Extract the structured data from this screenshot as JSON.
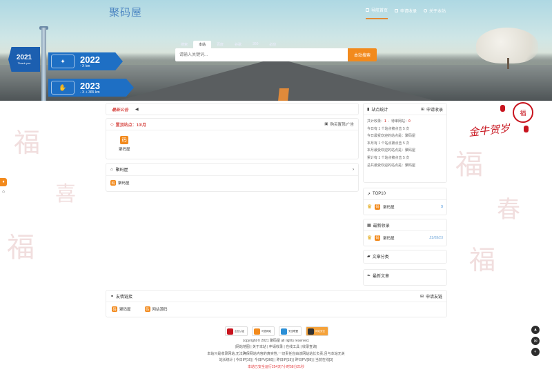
{
  "brand": {
    "logo": "聚码屋"
  },
  "nav": [
    {
      "label": "导航首页",
      "icon": "home-icon",
      "active": true
    },
    {
      "label": "申请收录",
      "icon": "edit-icon",
      "active": false
    },
    {
      "label": "关于本站",
      "icon": "info-icon",
      "active": false
    }
  ],
  "search": {
    "tabs": [
      "搜索",
      "本站",
      "百度",
      "谷歌",
      "360",
      "必应"
    ],
    "active_tab": "本站",
    "placeholder": "请输入关键词...",
    "button": "本站搜索"
  },
  "hero_signs": {
    "small": {
      "year": "2021",
      "sub": "Thank you"
    },
    "sign1": {
      "year": "2022",
      "km": "- X km"
    },
    "sign2": {
      "year": "2023",
      "km": "- X + 365 km"
    }
  },
  "notice": {
    "label": "最新公告",
    "icon": "megaphone-icon"
  },
  "featured": {
    "title": "置顶站点：10/月",
    "buy": "购买置顶/广告",
    "sites": [
      {
        "name": "聚码屋"
      }
    ]
  },
  "category": {
    "title": "聚码屋",
    "items": [
      {
        "name": "聚码屋"
      }
    ]
  },
  "stats": {
    "title": "站点统计",
    "apply": "申请收录",
    "total_label": "共计收录：",
    "total_value": "1",
    "pending_label": "待审网站：",
    "pending_value": "0",
    "lines": [
      "今日有 1 个站点被点击 5 次",
      "今日最受欢迎的站点是：聚码屋",
      "本月有 1 个站点被点击 5 次",
      "本月最受欢迎的站点是：聚码屋",
      "累计有 1 个站点被点击 5 次",
      "总共最受欢迎的站点是：聚码屋"
    ]
  },
  "top10": {
    "title": "TOP10",
    "items": [
      {
        "name": "聚码屋",
        "value": "5"
      }
    ]
  },
  "latest": {
    "title": "最新收录",
    "items": [
      {
        "name": "聚码屋",
        "date": "21/09/15"
      }
    ]
  },
  "article_cat": {
    "title": "文章分类"
  },
  "latest_articles": {
    "title": "最新文章"
  },
  "friends": {
    "title": "友情链接",
    "apply": "申请友链",
    "links": [
      "聚码屋",
      "网站源码"
    ]
  },
  "badges": [
    "企业认证",
    "可信网站",
    "安全联盟",
    "网站安全"
  ],
  "footer": {
    "copyright": "copyright © 2021 聚码屋 all rights reserved.",
    "links": "|网站地图 | 关于本站 | 申请收录 | 在线工具 | 收录查询|",
    "disclaimer": "本站只是收录网站,无法确保网站内容的真实性,一切责任应由该网站站长负责,且与本站无关",
    "counter": "站长统计 | 今日IP[16] | 今日PV[366] | 昨日IP[19] | 昨日PV[86] | 当前在线[3]",
    "runtime": "本站已安全运行254天7小时58分21秒"
  },
  "newyear": {
    "title": "金牛贺岁",
    "seal": "福"
  }
}
